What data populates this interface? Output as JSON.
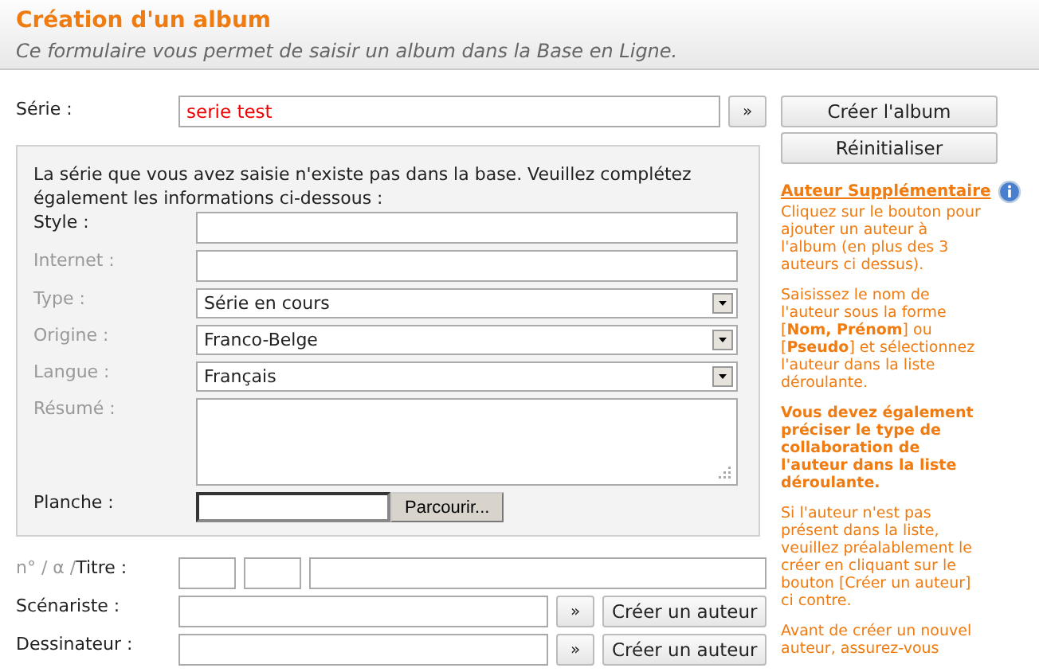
{
  "header": {
    "title": "Création d'un album",
    "subtitle": "Ce formulaire vous permet de saisir un album dans la Base en Ligne."
  },
  "serie": {
    "label": "Série :",
    "value": "serie test",
    "button": "»"
  },
  "actions": [
    "Créer l'album",
    "Réinitialiser"
  ],
  "panel": {
    "message": "La série que vous avez saisie n'existe pas dans la base. Veuillez complétez également les informations ci-dessous :",
    "fields": [
      {
        "label": "Style :",
        "required": true,
        "kind": "text"
      },
      {
        "label": "Internet :",
        "required": false,
        "kind": "text"
      },
      {
        "label": "Type :",
        "required": false,
        "kind": "select",
        "value": "Série en cours"
      },
      {
        "label": "Origine :",
        "required": false,
        "kind": "select",
        "value": "Franco-Belge"
      },
      {
        "label": "Langue :",
        "required": false,
        "kind": "select",
        "value": "Français"
      },
      {
        "label": "Résumé :",
        "required": false,
        "kind": "textarea"
      },
      {
        "label": "Planche :",
        "required": true,
        "kind": "file",
        "button": "Parcourir..."
      }
    ]
  },
  "title_row": {
    "label_parts": [
      {
        "text": "n° / α /",
        "required": false
      },
      {
        "text": "Titre :",
        "required": true
      }
    ]
  },
  "authors": [
    {
      "label": "Scénariste :",
      "button": "»",
      "create": "Créer un auteur"
    },
    {
      "label": "Dessinateur :",
      "button": "»",
      "create": "Créer un auteur"
    }
  ],
  "help": {
    "link": "Auteur Supplémentaire",
    "paragraphs": [
      {
        "text": "Cliquez sur le bouton pour ajouter un auteur à l'album (en plus des 3 auteurs ci dessus).",
        "bold": false
      },
      {
        "text": "Saisissez le nom de l'auteur sous la forme [**Nom, Prénom**] ou [**Pseudo**] et sélectionnez l'auteur dans la liste déroulante.",
        "bold": false
      },
      {
        "text": "Vous devez également préciser le type de collaboration de l'auteur dans la liste déroulante.",
        "bold": true
      },
      {
        "text": "Si l'auteur n'est pas présent dans la liste, veuillez préalablement le créer en cliquant sur le bouton [Créer un auteur] ci contre.",
        "bold": false
      },
      {
        "text": "Avant de créer un nouvel auteur, assurez-vous",
        "bold": false
      }
    ]
  }
}
